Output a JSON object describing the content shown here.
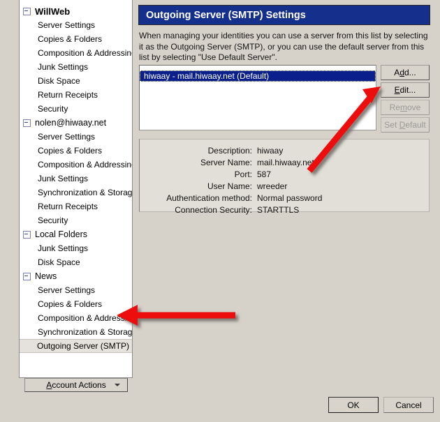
{
  "sidebar": {
    "groups": [
      {
        "label": "WillWeb",
        "bold": true,
        "items": [
          "Server Settings",
          "Copies & Folders",
          "Composition & Addressing",
          "Junk Settings",
          "Disk Space",
          "Return Receipts",
          "Security"
        ]
      },
      {
        "label": "nolen@hiwaay.net",
        "bold": false,
        "items": [
          "Server Settings",
          "Copies & Folders",
          "Composition & Addressing",
          "Junk Settings",
          "Synchronization & Storage",
          "Return Receipts",
          "Security"
        ]
      },
      {
        "label": "Local Folders",
        "bold": false,
        "items": [
          "Junk Settings",
          "Disk Space"
        ]
      },
      {
        "label": "News",
        "bold": false,
        "items": [
          "Server Settings",
          "Copies & Folders",
          "Composition & Addressing",
          "Synchronization & Storage"
        ]
      }
    ],
    "selected_item": "Outgoing Server (SMTP)",
    "account_actions": {
      "label_before": "A",
      "label_after": "ccount Actions",
      "icon": "chevron-down-icon"
    }
  },
  "panel": {
    "header_title": "Outgoing Server (SMTP) Settings",
    "header_color": "#14308c",
    "description": "When managing your identities you can use a server from this list by selecting it as the Outgoing Server (SMTP), or you can use the default server from this list by selecting \"Use Default Server\".",
    "list": {
      "items": [
        {
          "label": "hiwaay - mail.hiwaay.net (Default)",
          "selected": true
        }
      ],
      "selection_color": "#0a1f8c"
    },
    "buttons": {
      "add": {
        "pre": "A",
        "accel": "d",
        "post": "d...",
        "enabled": true
      },
      "edit": {
        "accel": "E",
        "post": "dit...",
        "enabled": true
      },
      "remove": {
        "pre": "Re",
        "accel": "m",
        "post": "ove",
        "enabled": false
      },
      "set_default": {
        "pre": "Set ",
        "accel": "D",
        "post": "efault",
        "enabled": false
      }
    },
    "details": [
      {
        "label": "Description:",
        "value": "hiwaay"
      },
      {
        "label": "Server Name:",
        "value": "mail.hiwaay.net"
      },
      {
        "label": "Port:",
        "value": "587"
      },
      {
        "label": "User Name:",
        "value": "wreeder"
      },
      {
        "label": "Authentication method:",
        "value": "Normal password"
      },
      {
        "label": "Connection Security:",
        "value": "STARTTLS"
      }
    ]
  },
  "dialog_buttons": {
    "ok": "OK",
    "cancel": "Cancel"
  },
  "annotations": {
    "arrow_color": "#ee1111",
    "arrow_to_edit_button": "arrow-pointing-to-edit-button",
    "arrow_to_smtp_item": "arrow-pointing-to-outgoing-server-item"
  }
}
